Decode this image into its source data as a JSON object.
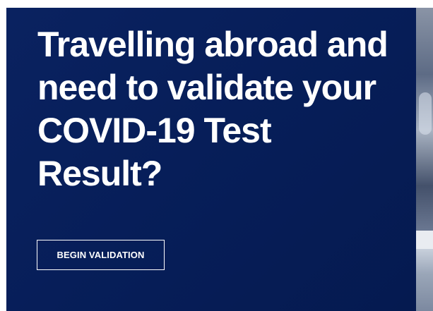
{
  "hero": {
    "headline_lines": [
      "Travelling abroad and",
      "need to validate your",
      "COVID-19 Test",
      "Result?"
    ],
    "cta_label": "BEGIN VALIDATION"
  },
  "colors": {
    "hero_background": "#061d57",
    "text": "#ffffff",
    "button_border": "#ffffff"
  }
}
